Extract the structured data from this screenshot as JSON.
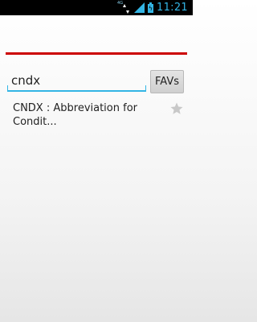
{
  "status_bar": {
    "network_label": "4G",
    "time": "11:21"
  },
  "search": {
    "value": "cndx",
    "favs_label": "FAVs"
  },
  "results": [
    {
      "text": "CNDX : Abbreviation for Condit..."
    }
  ],
  "colors": {
    "accent": "#33b5e5",
    "divider": "#cc0000",
    "star": "#c8c8c8"
  }
}
